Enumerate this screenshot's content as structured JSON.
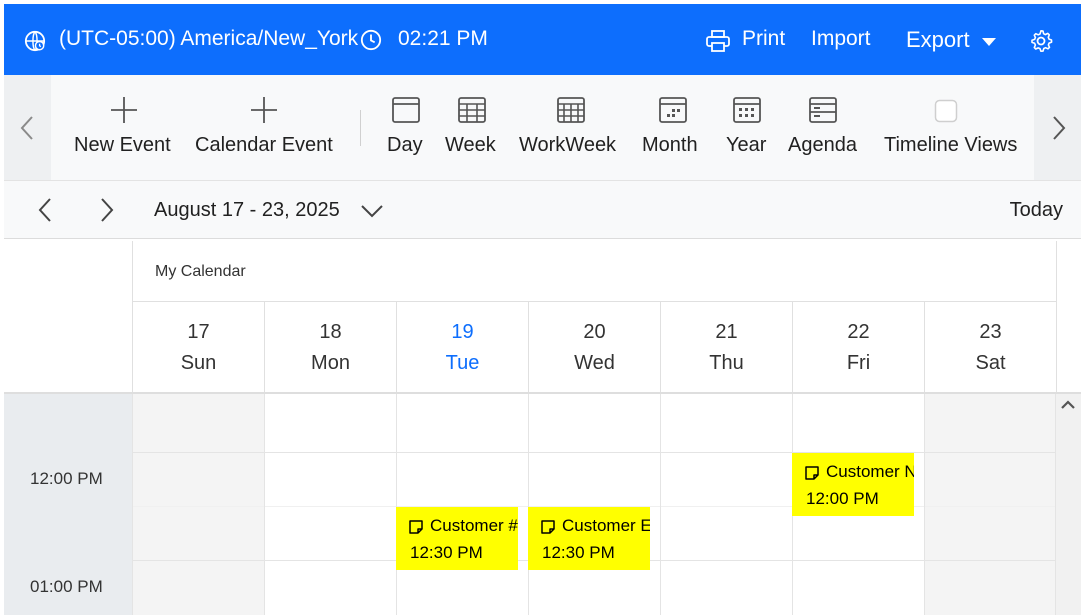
{
  "header": {
    "timezone": "(UTC-05:00) America/New_York",
    "time": "02:21 PM",
    "print_label": "Print",
    "import_label": "Import",
    "export_label": "Export",
    "accent_color": "#0d6efd"
  },
  "toolbar": {
    "items": [
      {
        "label": "New Event",
        "icon": "plus-icon"
      },
      {
        "label": "Calendar Event",
        "icon": "plus-icon"
      },
      {
        "label": "Day",
        "icon": "day-view-icon"
      },
      {
        "label": "Week",
        "icon": "week-view-icon"
      },
      {
        "label": "WorkWeek",
        "icon": "workweek-view-icon"
      },
      {
        "label": "Month",
        "icon": "month-view-icon"
      },
      {
        "label": "Year",
        "icon": "year-view-icon"
      },
      {
        "label": "Agenda",
        "icon": "agenda-view-icon"
      },
      {
        "label": "Timeline Views",
        "icon": "checkbox-icon"
      }
    ]
  },
  "date_nav": {
    "range": "August 17 - 23, 2025",
    "today_label": "Today"
  },
  "calendar": {
    "resource": "My Calendar",
    "days": [
      {
        "num": "17",
        "name": "Sun"
      },
      {
        "num": "18",
        "name": "Mon"
      },
      {
        "num": "19",
        "name": "Tue"
      },
      {
        "num": "20",
        "name": "Wed"
      },
      {
        "num": "21",
        "name": "Thu"
      },
      {
        "num": "22",
        "name": "Fri"
      },
      {
        "num": "23",
        "name": "Sat"
      }
    ],
    "current_day": "19",
    "time_labels": [
      "12:00 PM",
      "01:00 PM"
    ],
    "events": [
      {
        "subject": "Customer #",
        "time": "12:30 PM",
        "day": "Tue",
        "color": "#ffff00"
      },
      {
        "subject": "Customer E",
        "time": "12:30 PM",
        "day": "Wed",
        "color": "#ffff00"
      },
      {
        "subject": "Customer N",
        "time": "12:00 PM",
        "day": "Fri",
        "color": "#ffff00"
      }
    ]
  }
}
